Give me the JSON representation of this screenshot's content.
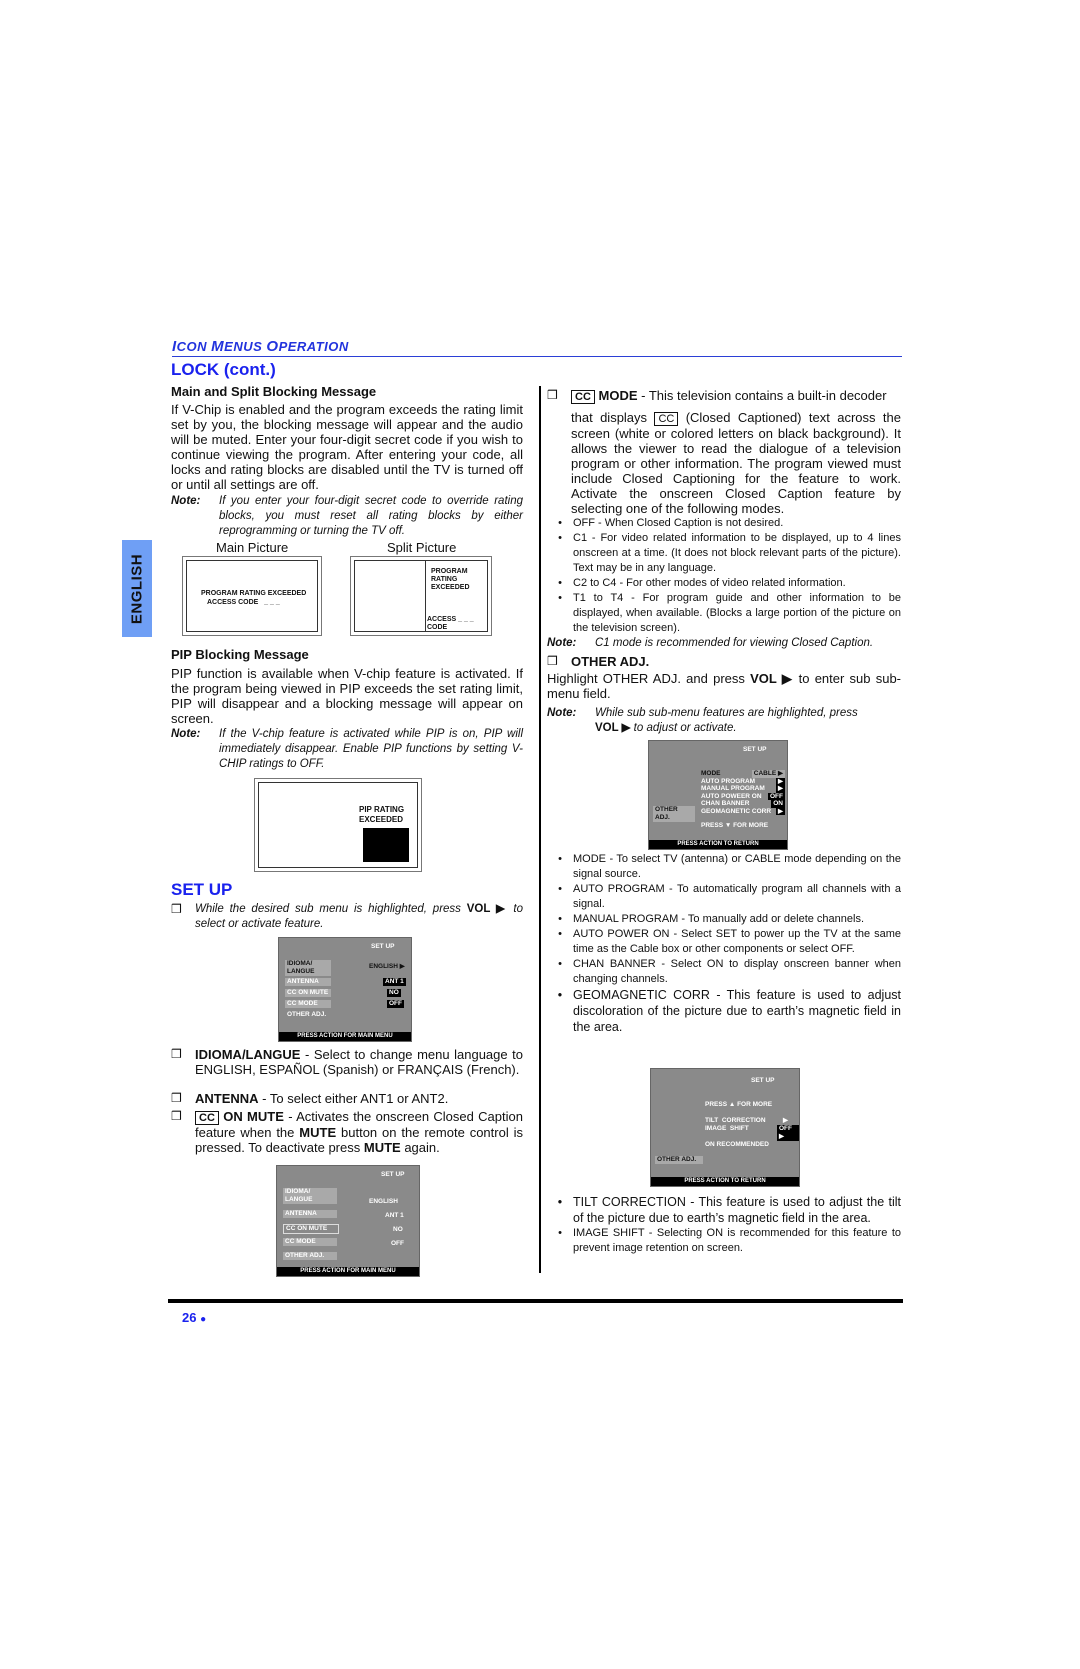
{
  "header": {
    "section": "ICON MENUS OPERATION",
    "cap_parts": [
      "I",
      "CON ",
      "M",
      "ENUS ",
      "O",
      "PERATION"
    ]
  },
  "side_tab": "ENGLISH",
  "left": {
    "lock_title": "LOCK (cont.)",
    "main_split_heading": "Main and Split Blocking Message",
    "main_split_text": "If V-Chip is enabled and the program exceeds the rating limit set by you, the blocking message will appear and the audio will be muted. Enter your four-digit secret code if you wish to continue viewing the program. After entering your code, all locks and rating blocks are disabled until the TV is turned off or until all settings are off.",
    "note_label": "Note:",
    "note1": "If you enter your four-digit secret code to override rating blocks, you must reset all rating blocks by either reprogramming or turning the TV off.",
    "main_picture_label": "Main Picture",
    "split_picture_label": "Split Picture",
    "main_picture_msg1": "PROGRAM RATING EXCEEDED",
    "main_picture_msg2": "ACCESS CODE   _ _ _",
    "split_msg1": "PROGRAM",
    "split_msg2": "RATING",
    "split_msg3": "EXCEEDED",
    "split_access": "ACCESS _ _ _",
    "split_code": "CODE",
    "pip_heading": "PIP Blocking Message",
    "pip_text": "PIP function is available when V-chip feature is activated. If the program being viewed in PIP exceeds the set rating limit, PIP will disappear and a blocking message will appear on screen.",
    "note2": "If the V-chip feature is activated while PIP is on, PIP will immediately disappear. Enable PIP functions by setting V-CHIP ratings to OFF.",
    "pip_msg1": "PIP RATING",
    "pip_msg2": "EXCEEDED",
    "setup_title": "SET UP",
    "setup_intro_a": "While the desired sub menu is highlighted, press ",
    "setup_intro_b": "VOL ▶",
    "setup_intro_c": " to select or activate feature.",
    "osd1": {
      "title": "SET UP",
      "items": [
        "IDIOMA/ LANGUE",
        "ANTENNA",
        "CC ON MUTE",
        "CC MODE",
        "OTHER ADJ."
      ],
      "values": [
        "ENGLISH ▶",
        "ANT 1",
        "NO",
        "OFF"
      ],
      "footer": "PRESS ACTION FOR MAIN MENU"
    },
    "idioma_label": "IDIOMA/LANGUE",
    "idioma_text": " - Select to change menu language to ENGLISH, ESPAÑOL (Spanish) or FRANÇAIS (French).",
    "antenna_label": "ANTENNA",
    "antenna_text": " - To select either ANT1 or ANT2.",
    "cc_glyph": "CC",
    "onmute_label": "ON MUTE",
    "onmute_text_a": " - Activates the onscreen Closed Caption feature when the ",
    "mute": "MUTE",
    "onmute_text_b": " button on the remote control is pressed. To deactivate press ",
    "onmute_text_c": " again.",
    "osd2": {
      "title": "SET UP",
      "items": [
        "IDIOMA/ LANGUE",
        "ANTENNA",
        "CC ON MUTE",
        "CC MODE",
        "OTHER ADJ."
      ],
      "values": [
        "ENGLISH",
        "ANT 1",
        "NO",
        "OFF"
      ],
      "footer": "PRESS ACTION FOR MAIN MENU"
    }
  },
  "right": {
    "ccmode_label": "MODE",
    "ccmode_text1": " - This television contains a built-in decoder",
    "ccmode_text2a": "that displays ",
    "ccmode_text2b": " (Closed Captioned) text across the screen (white or colored letters on black background). It allows the viewer to read the dialogue of a television program or other information. The program viewed must include Closed Captioning for the feature to work. Activate the onscreen Closed Caption feature by selecting one of the following modes.",
    "modes": [
      "OFF - When Closed Caption is not desired.",
      "C1 - For video related information to be displayed, up to 4 lines onscreen at a time. (It does not block relevant parts of the picture). Text may be in any language.",
      "C2 to C4 - For other modes of video related information.",
      "T1 to T4 - For program guide and other information to be displayed, when available. (Blocks a large portion of the picture on the television screen)."
    ],
    "note_label": "Note:",
    "note3": "C1 mode is recommended for viewing Closed Caption.",
    "other_adj_label": "OTHER ADJ.",
    "other_text_a": "Highlight OTHER ADJ. and press ",
    "vol": "VOL ▶",
    "other_text_b": " to enter sub sub-menu field.",
    "note4a": "While sub sub-menu features are highlighted, press",
    "note4b": " to adjust or activate.",
    "osd3": {
      "title": "SET UP",
      "rows": [
        {
          "label": "MODE",
          "value": "CABLE ▶"
        },
        {
          "label": "AUTO PROGRAM",
          "value": "▶"
        },
        {
          "label": "MANUAL PROGRAM",
          "value": "▶"
        },
        {
          "label": "AUTO POWEER ON",
          "value": "OFF"
        },
        {
          "label": "CHAN BANNER",
          "value": "ON"
        },
        {
          "label": "GEOMAGNETIC CORR",
          "value": "▶"
        }
      ],
      "side": "OTHER ADJ.",
      "press": "PRESS  ▼  FOR MORE",
      "footer": "PRESS ACTION TO RETURN"
    },
    "features": [
      "MODE - To select TV (antenna) or CABLE mode depending on the signal source.",
      "AUTO PROGRAM - To automatically program all channels with a signal.",
      "MANUAL PROGRAM - To manually add or delete channels.",
      "AUTO POWER ON - Select SET to power up the TV at the same time as the Cable box or other components or select OFF.",
      "CHAN BANNER - Select ON to display onscreen banner when changing channels.",
      "GEOMAGNETIC CORR - This feature is used to adjust discoloration of the picture due to earth’s magnetic field in the area."
    ],
    "osd4": {
      "title": "SET UP",
      "press": "PRESS ▲ FOR MORE",
      "rows": [
        {
          "label": "TILT  CORRECTION",
          "value": "▶"
        },
        {
          "label": "IMAGE  SHIFT",
          "value": "OFF ▶"
        }
      ],
      "recommend": "ON RECOMMENDED",
      "side": "OTHER ADJ.",
      "footer": "PRESS ACTION TO RETURN"
    },
    "features2": [
      "TILT CORRECTION - This feature is used to adjust the tilt of the picture due to earth’s magnetic field in the area.",
      "IMAGE SHIFT - Selecting ON is recommended for this feature to prevent image retention on screen."
    ]
  },
  "footer": {
    "page": "26",
    "dot": "●"
  }
}
